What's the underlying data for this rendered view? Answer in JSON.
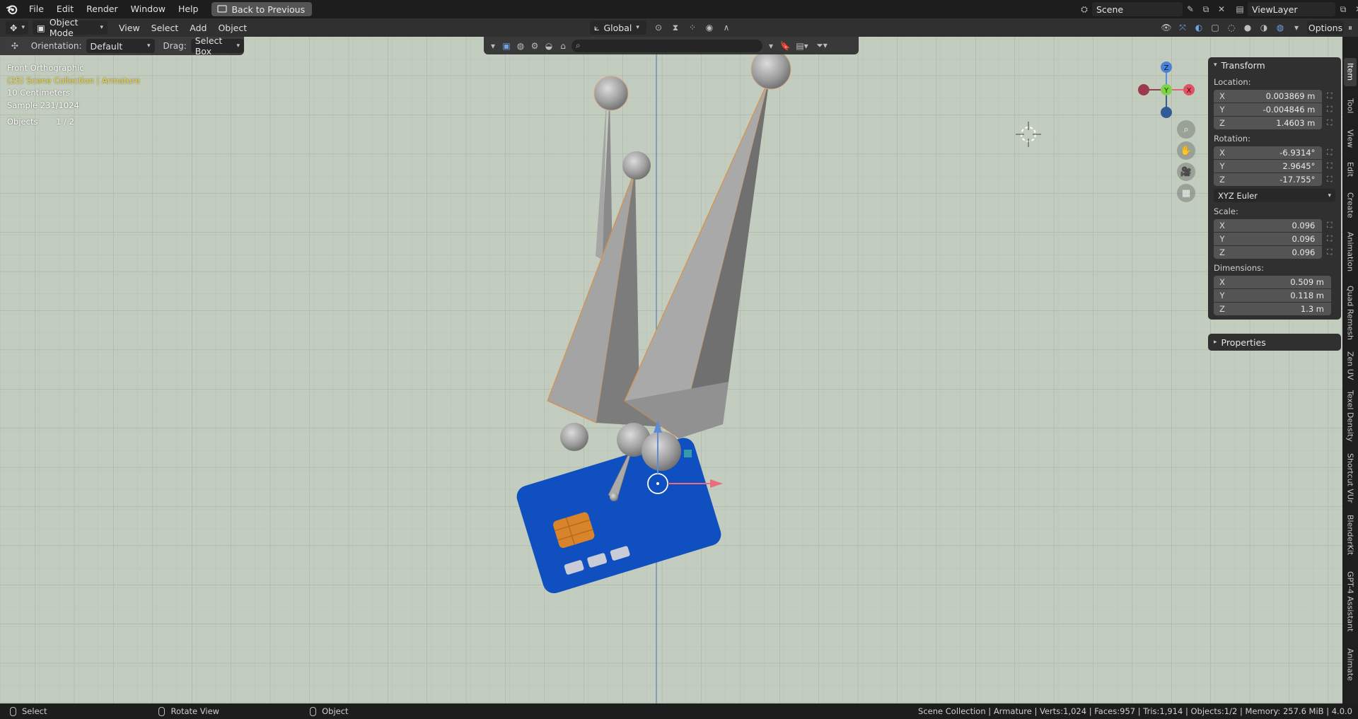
{
  "menubar": {
    "items": [
      "File",
      "Edit",
      "Render",
      "Window",
      "Help"
    ],
    "back_button": "Back to Previous",
    "scene": "Scene",
    "view_layer": "ViewLayer"
  },
  "header": {
    "mode": "Object Mode",
    "menus": [
      "View",
      "Select",
      "Add",
      "Object"
    ],
    "transform_orientation": "Global",
    "options": "Options"
  },
  "tool_header": {
    "orientation_label": "Orientation:",
    "orientation_value": "Default",
    "drag_label": "Drag:",
    "drag_value": "Select Box"
  },
  "viewport_info": {
    "view": "Front Orthographic",
    "collection": "(25) Scene Collection | Armature",
    "scale": "10 Centimeters",
    "sample": "Sample 231/1024",
    "objects_label": "Objects",
    "objects_value": "1 / 2"
  },
  "gizmo": {
    "x": "X",
    "y": "Y",
    "z": "Z"
  },
  "transform": {
    "title": "Transform",
    "location_label": "Location:",
    "location": [
      {
        "axis": "X",
        "value": "0.003869 m"
      },
      {
        "axis": "Y",
        "value": "-0.004846 m"
      },
      {
        "axis": "Z",
        "value": "1.4603 m"
      }
    ],
    "rotation_label": "Rotation:",
    "rotation": [
      {
        "axis": "X",
        "value": "-6.9314°"
      },
      {
        "axis": "Y",
        "value": "2.9645°"
      },
      {
        "axis": "Z",
        "value": "-17.755°"
      }
    ],
    "rotation_mode": "XYZ Euler",
    "scale_label": "Scale:",
    "scale": [
      {
        "axis": "X",
        "value": "0.096"
      },
      {
        "axis": "Y",
        "value": "0.096"
      },
      {
        "axis": "Z",
        "value": "0.096"
      }
    ],
    "dimensions_label": "Dimensions:",
    "dimensions": [
      {
        "axis": "X",
        "value": "0.509 m"
      },
      {
        "axis": "Y",
        "value": "0.118 m"
      },
      {
        "axis": "Z",
        "value": "1.3 m"
      }
    ]
  },
  "properties_panel": {
    "title": "Properties"
  },
  "sidebar_tabs": [
    "Item",
    "Tool",
    "View",
    "Edit",
    "Create",
    "Animation",
    "Quad Remesh",
    "Zen UV",
    "Texel Density",
    "Shortcut VUr",
    "BlenderKit",
    "GPT-4 Assistant",
    "Animate"
  ],
  "statusbar": {
    "select": "Select",
    "rotate_view": "Rotate View",
    "object": "Object",
    "stats": "Scene Collection | Armature | Verts:1,024 | Faces:957 | Tris:1,914 | Objects:1/2 | Memory: 257.6 MiB | 4.0.0"
  },
  "colors": {
    "viewport_bg": "#c3cdbf",
    "card_blue": "#0f4fbf",
    "chip_orange": "#d8842a",
    "selection_outline": "#e58a2e",
    "active_text": "#ecd437"
  }
}
